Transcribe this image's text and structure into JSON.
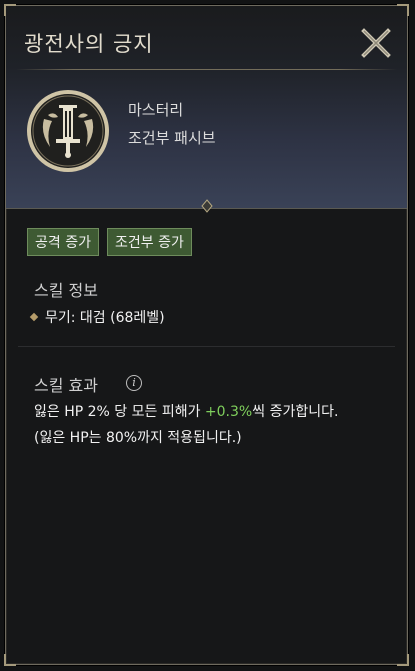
{
  "window": {
    "title": "광전사의 긍지"
  },
  "skill": {
    "icon": "berserker-crest-icon",
    "type": "마스터리",
    "subtype": "조건부 패시브"
  },
  "tags": [
    "공격 증가",
    "조건부 증가"
  ],
  "info": {
    "heading": "스킬 정보",
    "weapon": "무기: 대검 (68레벨)"
  },
  "effect": {
    "heading": "스킬 효과",
    "line1_prefix": "잃은 HP 2% 당 모든 피해가 ",
    "line1_value": "+0.3%",
    "line1_suffix": "씩 증가합니다.",
    "line2": "(잃은 HP는 80%까지 적용됩니다.)"
  },
  "colors": {
    "accent_green": "#7fcf5c",
    "tag_bg": "#3e5a33",
    "frame_gold": "#a59a7c"
  }
}
